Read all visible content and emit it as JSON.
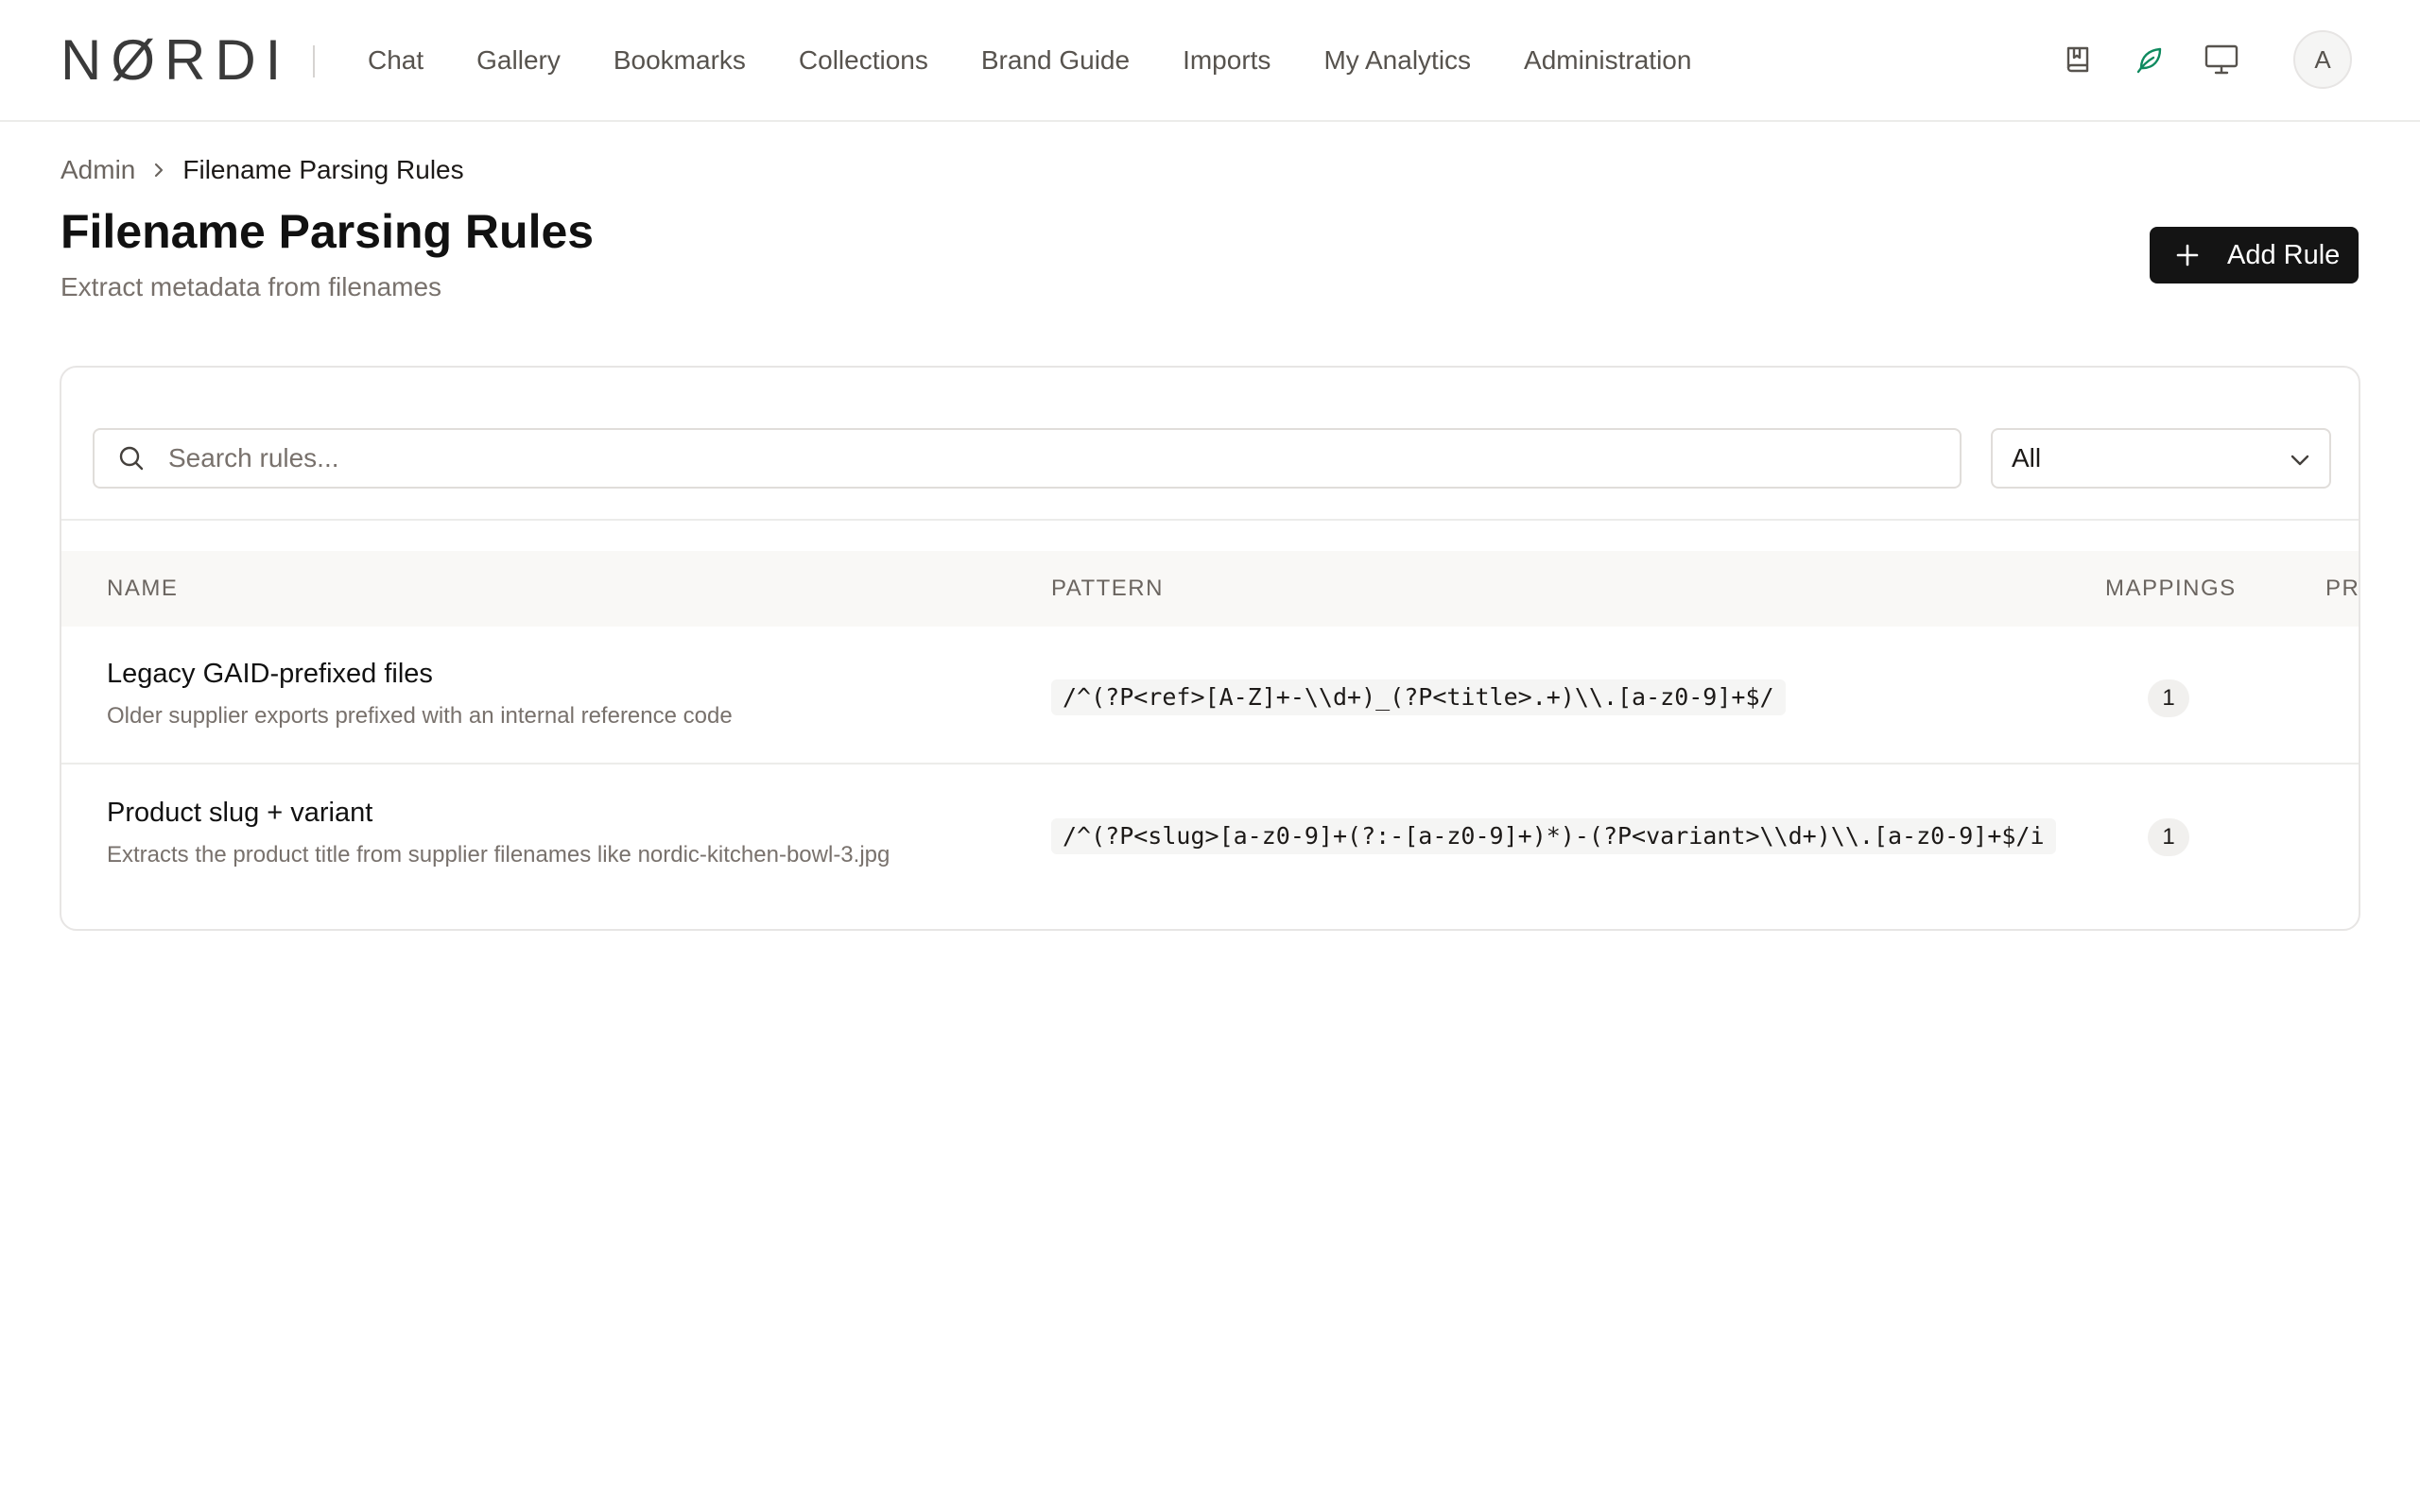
{
  "app": {
    "logo_text": "NØRDI"
  },
  "nav": {
    "items": [
      {
        "label": "Chat"
      },
      {
        "label": "Gallery"
      },
      {
        "label": "Bookmarks"
      },
      {
        "label": "Collections"
      },
      {
        "label": "Brand Guide"
      },
      {
        "label": "Imports"
      },
      {
        "label": "My Analytics"
      },
      {
        "label": "Administration"
      }
    ],
    "icons": [
      "bookmark-book-icon",
      "leaf-icon",
      "monitor-icon"
    ],
    "leaf_color": "#0f8a5f",
    "avatar_initial": "A"
  },
  "breadcrumb": {
    "parent": "Admin",
    "current": "Filename Parsing Rules"
  },
  "header": {
    "title": "Filename Parsing Rules",
    "subtitle": "Extract metadata from filenames",
    "add_button_label": "Add Rule"
  },
  "filters": {
    "search_placeholder": "Search rules...",
    "search_value": "",
    "select_value": "All"
  },
  "table": {
    "columns": [
      "NAME",
      "PATTERN",
      "MAPPINGS",
      "PRI"
    ],
    "rows": [
      {
        "name": "Legacy GAID-prefixed files",
        "description": "Older supplier exports prefixed with an internal reference code",
        "pattern": "/^(?P<ref>[A-Z]+-\\\\d+)_(?P<title>.+)\\\\.[a-z0-9]+$/",
        "mappings": "1"
      },
      {
        "name": "Product slug + variant",
        "description": "Extracts the product title from supplier filenames like nordic-kitchen-bowl-3.jpg",
        "pattern": "/^(?P<slug>[a-z0-9]+(?:-[a-z0-9]+)*)-(?P<variant>\\\\d+)\\\\.[a-z0-9]+$/i",
        "mappings": "1"
      }
    ]
  },
  "colors": {
    "primary_button": "#141414",
    "accent_leaf": "#0f8a5f"
  }
}
